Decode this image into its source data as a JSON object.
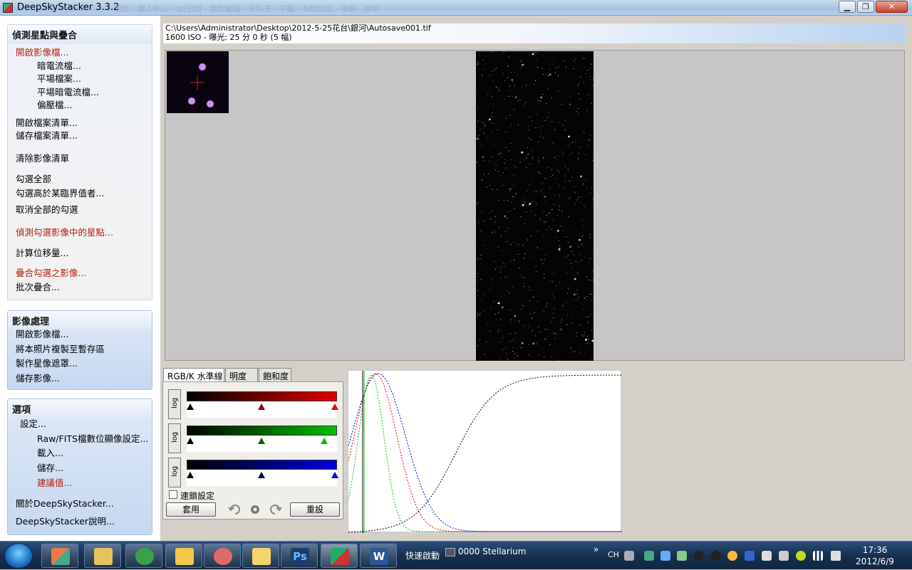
{
  "window": {
    "title": "DeepSkyStacker 3.3.2",
    "background_titles": "寫信   ·   個人中心   ·   qq空間   ·   我的電腦   ·   資料夾   ·   下載   ·   系統設定   ·   搜尋   ·   說明",
    "min_label": "▁",
    "max_label": "❐",
    "close_label": "✕"
  },
  "sidebar": {
    "group1": {
      "title": "偵測星點與疊合",
      "items": [
        {
          "label": "開啟影像檔..."
        },
        {
          "label": "暗電流檔..."
        },
        {
          "label": "平場檔案..."
        },
        {
          "label": "平場暗電流檔..."
        },
        {
          "label": "偏壓檔..."
        },
        {
          "label": "開啟檔案清單..."
        },
        {
          "label": "儲存檔案清單..."
        },
        {
          "label": "清除影像清單"
        },
        {
          "label": "勾選全部"
        },
        {
          "label": "勾選高於某臨界值者..."
        },
        {
          "label": "取消全部的勾選"
        },
        {
          "label": "偵測勾選影像中的星點..."
        },
        {
          "label": "計算位移量..."
        },
        {
          "label": "疊合勾選之影像..."
        },
        {
          "label": "批次疊合..."
        }
      ]
    },
    "group2": {
      "title": "影像處理",
      "items": [
        {
          "label": "開啟影像檔..."
        },
        {
          "label": "將本照片複製至暫存區"
        },
        {
          "label": "製作星像遮罩..."
        },
        {
          "label": "儲存影像..."
        }
      ]
    },
    "group3": {
      "title": "選項",
      "items": [
        {
          "label": "設定..."
        },
        {
          "label": "Raw/FITS檔數位顯像設定..."
        },
        {
          "label": "載入..."
        },
        {
          "label": "儲存..."
        },
        {
          "label": "建議值..."
        },
        {
          "label": "關於DeepSkyStacker..."
        },
        {
          "label": "DeepSkyStacker說明..."
        }
      ]
    }
  },
  "file": {
    "path": "C:\\Users\\Administrator\\Desktop\\2012-5-25花台\\銀河\\Autosave001.tif",
    "info": "1600 ISO - 曝光: 25 分 0 秒 (5 幅)"
  },
  "tabs": [
    {
      "label": "RGB/K 水準線"
    },
    {
      "label": "明度"
    },
    {
      "label": "飽和度"
    }
  ],
  "curves": {
    "log_label": "log",
    "link_label": "連鎖設定",
    "apply_label": "套用",
    "reset_label": "重設",
    "red_levels": [
      0,
      0.5,
      1.0
    ],
    "green_levels": [
      0,
      0.5,
      0.93
    ],
    "blue_levels": [
      0,
      0.5,
      1.0
    ],
    "colors": {
      "red": "#e00000",
      "green": "#00c000",
      "blue": "#0000e0"
    }
  },
  "taskbar": {
    "quicklaunch_label": "快速啟動",
    "running_label": "0000 Stellarium",
    "chevron": "»",
    "ime": "CH",
    "time": "17:36",
    "date": "2012/6/9",
    "apps": [
      {
        "icon": "library-icon"
      },
      {
        "icon": "explorer-icon"
      },
      {
        "icon": "refresh-icon"
      },
      {
        "icon": "notes-icon"
      },
      {
        "icon": "people-icon"
      },
      {
        "icon": "sticky-icon"
      },
      {
        "icon": "photoshop-icon",
        "label": "Ps"
      },
      {
        "icon": "deepskystacker-icon"
      },
      {
        "icon": "word-icon",
        "label": "W"
      }
    ]
  }
}
